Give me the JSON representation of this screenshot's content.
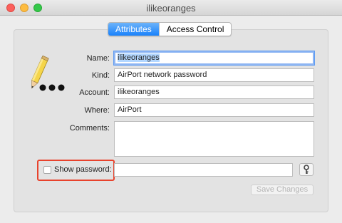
{
  "window": {
    "title": "ilikeoranges"
  },
  "tabs": [
    {
      "label": "Attributes",
      "active": true
    },
    {
      "label": "Access Control",
      "active": false
    }
  ],
  "form": {
    "name_label": "Name:",
    "name_value": "ilikeoranges",
    "kind_label": "Kind:",
    "kind_value": "AirPort network password",
    "account_label": "Account:",
    "account_value": "ilikeoranges",
    "where_label": "Where:",
    "where_value": "AirPort",
    "comments_label": "Comments:",
    "comments_value": "",
    "show_password_label": "Show password:",
    "show_password_checked": false,
    "password_value": "",
    "save_button_label": "Save Changes",
    "save_button_enabled": false
  },
  "icons": {
    "item_icon": "pencil-with-dots-icon",
    "password_assistant": "key-icon"
  },
  "colors": {
    "accent": "#1a82fb",
    "highlight": "#e8432d",
    "selection": "#b3d7ff"
  }
}
